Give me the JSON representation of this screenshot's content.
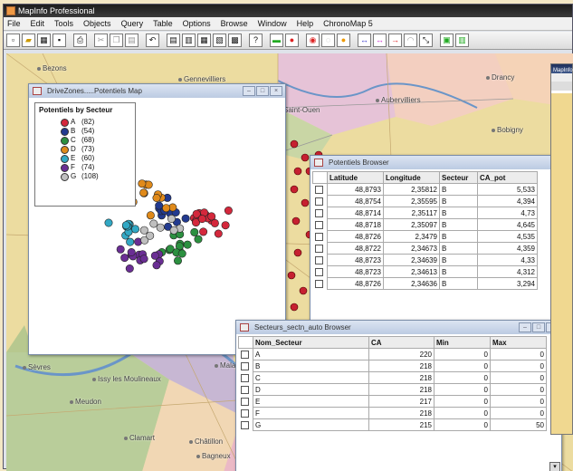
{
  "app": {
    "title": "MapInfo Professional"
  },
  "menu": [
    "File",
    "Edit",
    "Tools",
    "Objects",
    "Query",
    "Table",
    "Options",
    "Browse",
    "Window",
    "Help",
    "ChronoMap 5"
  ],
  "map_labels": [
    {
      "text": "Bezons"
    },
    {
      "text": "Gennevilliers"
    },
    {
      "text": "Drancy"
    },
    {
      "text": "Aubervilliers"
    },
    {
      "text": "Bobigny"
    },
    {
      "text": "Saint-Ouen"
    },
    {
      "text": "Sèvres"
    },
    {
      "text": "Issy les Moulineaux"
    },
    {
      "text": "Malakoff"
    },
    {
      "text": "Meudon"
    },
    {
      "text": "Clamart"
    },
    {
      "text": "Châtillon"
    },
    {
      "text": "Bagneux"
    }
  ],
  "map_window": {
    "title": "DriveZones.....Potentiels Map",
    "legend_title": "Potentiels by Secteur",
    "legend": [
      {
        "label": "A",
        "count": "(82)",
        "color": "#d4283c"
      },
      {
        "label": "B",
        "count": "(54)",
        "color": "#223a8f"
      },
      {
        "label": "C",
        "count": "(68)",
        "color": "#2c9040"
      },
      {
        "label": "D",
        "count": "(73)",
        "color": "#e08a1a"
      },
      {
        "label": "E",
        "count": "(60)",
        "color": "#32a8c4"
      },
      {
        "label": "F",
        "count": "(74)",
        "color": "#6a2e94"
      },
      {
        "label": "G",
        "count": "(108)",
        "color": "#bfbfbf"
      }
    ]
  },
  "potentiels_browser": {
    "title": "Potentiels Browser",
    "columns": [
      "Latitude",
      "Longitude",
      "Secteur",
      "CA_pot"
    ],
    "rows": [
      [
        "48,8793",
        "2,35812",
        "B",
        "5,533"
      ],
      [
        "48,8754",
        "2,35595",
        "B",
        "4,394"
      ],
      [
        "48,8714",
        "2,35117",
        "B",
        "4,73"
      ],
      [
        "48,8718",
        "2,35097",
        "B",
        "4,645"
      ],
      [
        "48,8726",
        "2,3479",
        "B",
        "4,535"
      ],
      [
        "48,8722",
        "2,34673",
        "B",
        "4,359"
      ],
      [
        "48,8723",
        "2,34639",
        "B",
        "4,33"
      ],
      [
        "48,8723",
        "2,34613",
        "B",
        "4,312"
      ],
      [
        "48,8726",
        "2,34636",
        "B",
        "3,294"
      ]
    ]
  },
  "secteurs_browser": {
    "title": "Secteurs_sectn_auto Browser",
    "columns": [
      "Nom_Secteur",
      "CA",
      "Min",
      "Max"
    ],
    "rows": [
      [
        "A",
        "220",
        "0",
        "0"
      ],
      [
        "B",
        "218",
        "0",
        "0"
      ],
      [
        "C",
        "218",
        "0",
        "0"
      ],
      [
        "D",
        "218",
        "0",
        "0"
      ],
      [
        "E",
        "217",
        "0",
        "0"
      ],
      [
        "F",
        "218",
        "0",
        "0"
      ],
      [
        "G",
        "215",
        "0",
        "50"
      ]
    ]
  },
  "right_window": {
    "title": "MapInfo"
  }
}
